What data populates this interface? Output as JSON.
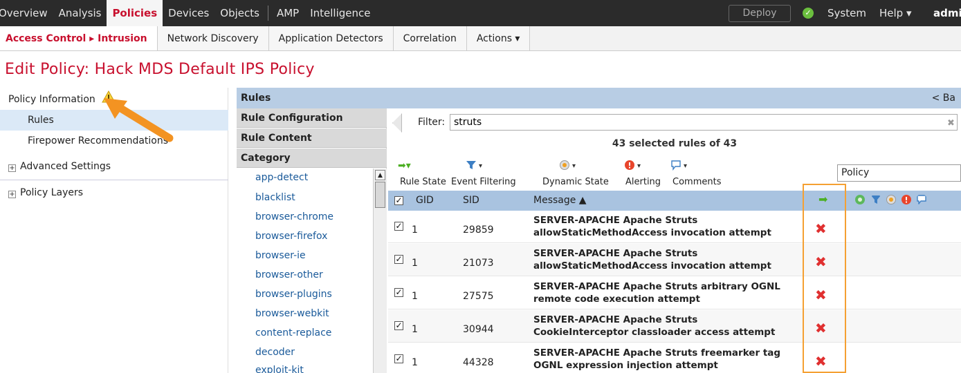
{
  "topnav": {
    "items": [
      "Overview",
      "Analysis",
      "Policies",
      "Devices",
      "Objects",
      "AMP",
      "Intelligence"
    ],
    "deploy": "Deploy",
    "system": "System",
    "help": "Help ▾",
    "user": "admi"
  },
  "subnav": {
    "items": [
      "Access Control ▸ Intrusion",
      "Network Discovery",
      "Application Detectors",
      "Correlation",
      "Actions ▾"
    ]
  },
  "page_title": "Edit Policy: Hack MDS Default IPS Policy",
  "left_panel": {
    "items": [
      "Policy Information",
      "Rules",
      "Firepower Recommendations",
      "Advanced Settings",
      "Policy Layers"
    ]
  },
  "rules": {
    "title": "Rules",
    "back": "< Ba",
    "cat_heads": [
      "Rule Configuration",
      "Rule Content",
      "Category"
    ],
    "categories": [
      "app-detect",
      "blacklist",
      "browser-chrome",
      "browser-firefox",
      "browser-ie",
      "browser-other",
      "browser-plugins",
      "browser-webkit",
      "content-replace",
      "decoder",
      "exploit-kit"
    ],
    "filter_label": "Filter:",
    "filter_value": "struts",
    "filter_clear": "✖",
    "count_text": "43 selected rules of 43",
    "toolbar": [
      "Rule State",
      "Event Filtering",
      "Dynamic State",
      "Alerting",
      "Comments"
    ],
    "policy_box": "Policy",
    "columns": {
      "gid": "GID",
      "sid": "SID",
      "message": "Message ▲"
    },
    "rows": [
      {
        "gid": "1",
        "sid": "29859",
        "msg1": "SERVER-APACHE Apache Struts",
        "msg2": "allowStaticMethodAccess invocation attempt"
      },
      {
        "gid": "1",
        "sid": "21073",
        "msg1": "SERVER-APACHE Apache Struts",
        "msg2": "allowStaticMethodAccess invocation attempt"
      },
      {
        "gid": "1",
        "sid": "27575",
        "msg1": "SERVER-APACHE Apache Struts arbitrary OGNL",
        "msg2": "remote code execution attempt"
      },
      {
        "gid": "1",
        "sid": "30944",
        "msg1": "SERVER-APACHE Apache Struts",
        "msg2": "CookieInterceptor classloader access attempt"
      },
      {
        "gid": "1",
        "sid": "44328",
        "msg1": "SERVER-APACHE Apache Struts freemarker tag",
        "msg2": "OGNL expression injection attempt"
      }
    ]
  },
  "colors": {
    "brand_red": "#c8102e",
    "highlight_orange": "#f5a032",
    "header_blue": "#a9c3e0"
  }
}
